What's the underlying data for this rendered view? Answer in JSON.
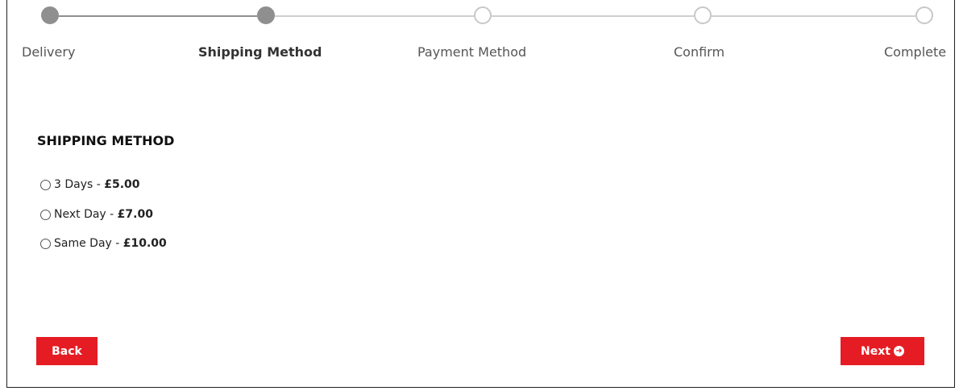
{
  "steps": [
    {
      "label": "Delivery",
      "state": "done"
    },
    {
      "label": "Shipping Method",
      "state": "active"
    },
    {
      "label": "Payment Method",
      "state": "todo"
    },
    {
      "label": "Confirm",
      "state": "todo"
    },
    {
      "label": "Complete",
      "state": "todo"
    }
  ],
  "shipping": {
    "title": "SHIPPING METHOD",
    "options": [
      {
        "name": "3 Days",
        "sep": " - ",
        "price": "£5.00"
      },
      {
        "name": "Next Day",
        "sep": " - ",
        "price": "£7.00"
      },
      {
        "name": "Same Day",
        "sep": " - ",
        "price": "£10.00"
      }
    ]
  },
  "buttons": {
    "back": "Back",
    "next": "Next"
  },
  "colors": {
    "accent": "#e51c23",
    "step_done": "#8f8f8f",
    "step_todo": "#c8c8c8"
  }
}
